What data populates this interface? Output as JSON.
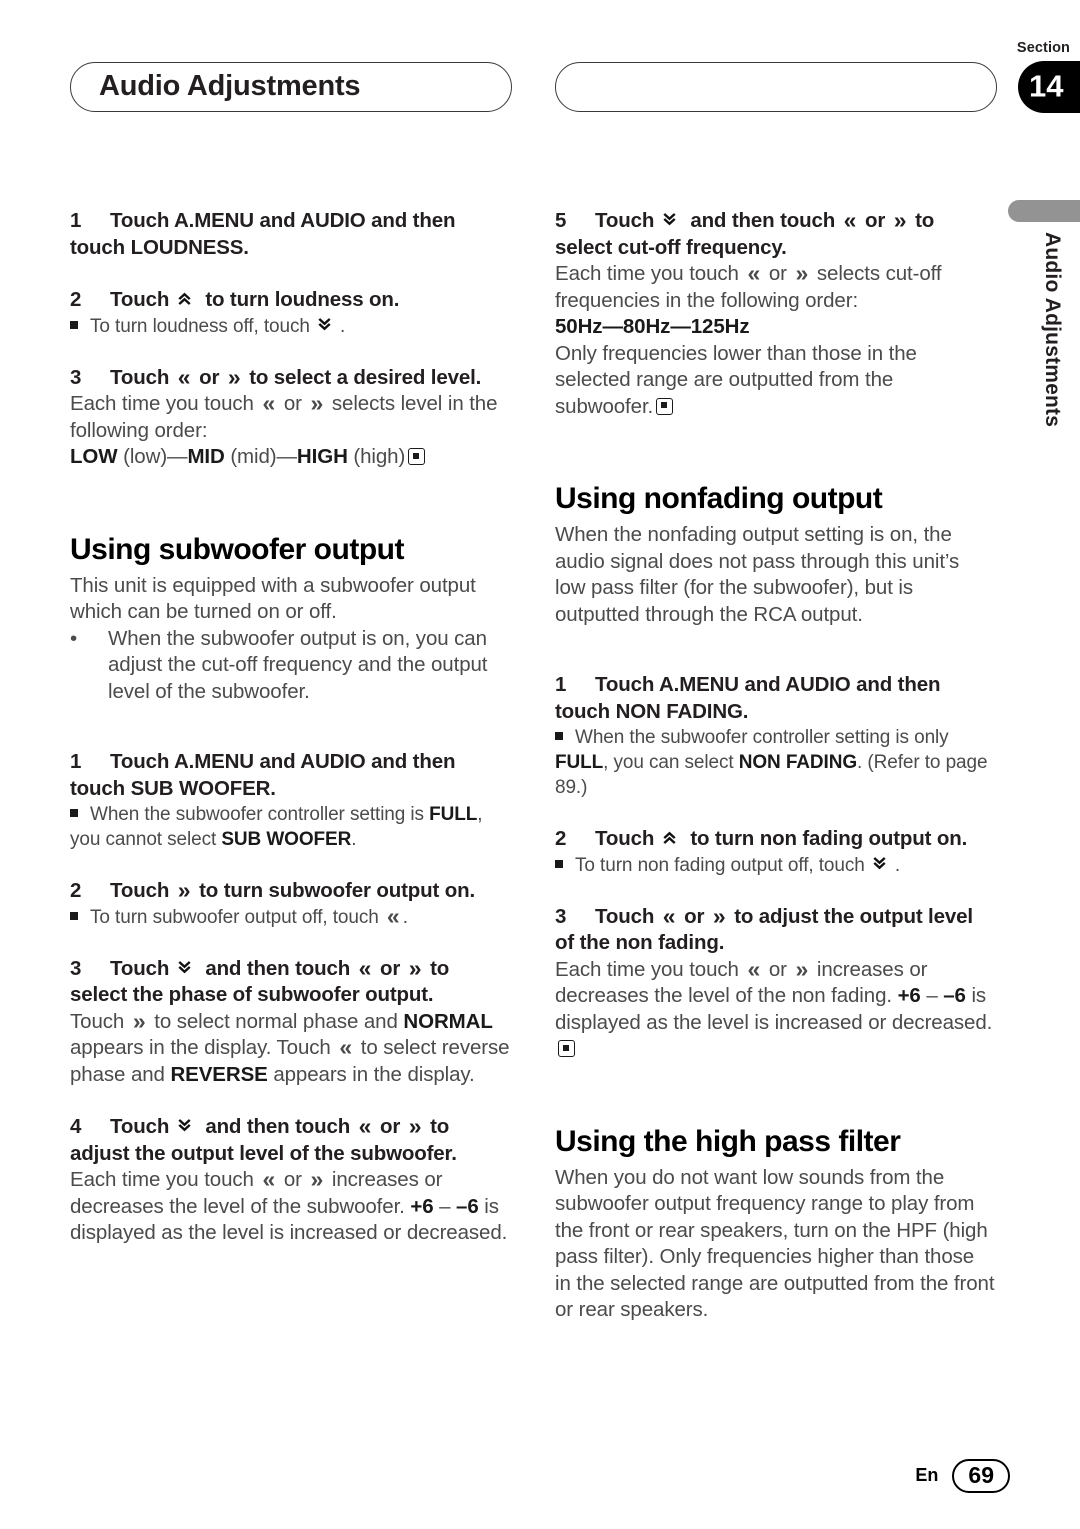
{
  "header": {
    "left_title": "Audio Adjustments",
    "right_title": "",
    "section_label": "Section",
    "section_number": "14"
  },
  "side_tab": {
    "text": "Audio Adjustments"
  },
  "icons": {
    "left": "«",
    "right": "»",
    "up": "double-chevron-up",
    "down": "double-chevron-down",
    "end": "end-of-procedure-marker"
  },
  "left_column": {
    "step1": {
      "num": "1",
      "text": "Touch A.MENU and AUDIO and then touch LOUDNESS."
    },
    "step2": {
      "num": "2",
      "pre": "Touch",
      "post": "to turn loudness on.",
      "note_pre": "To turn loudness off, touch",
      "note_post": "."
    },
    "step3": {
      "num": "3",
      "pre": "Touch",
      "mid": "or",
      "post": "to select a desired level.",
      "body_pre": "Each time you touch",
      "body_mid": "or",
      "body_post": "selects level in the following order:",
      "order_low_b": "LOW",
      "order_low": " (low)—",
      "order_mid_b": "MID",
      "order_mid": " (mid)—",
      "order_high_b": "HIGH",
      "order_high": " (high)"
    },
    "subwoofer_section": {
      "heading": "Using subwoofer output",
      "intro": "This unit is equipped with a subwoofer output which can be turned on or off.",
      "bullet": "When the subwoofer output is on, you can adjust the cut-off frequency and the output level of the subwoofer.",
      "step1": {
        "num": "1",
        "text": "Touch A.MENU and AUDIO and then touch SUB WOOFER.",
        "note_a": "When the subwoofer controller setting is ",
        "note_full": "FULL",
        "note_b": ", you cannot select ",
        "note_sw": "SUB WOOFER",
        "note_c": "."
      },
      "step2": {
        "num": "2",
        "pre": "Touch",
        "post": "to turn subwoofer output on.",
        "note_pre": "To turn subwoofer output off, touch",
        "note_post": "."
      },
      "step3": {
        "num": "3",
        "pre": "Touch",
        "mid1": "and then touch",
        "mid2": "or",
        "post": "to select the phase of subwoofer output.",
        "body_a": "Touch",
        "body_b": "to select normal phase and ",
        "body_normal": "NORMAL",
        "body_c": " appears in the display. Touch",
        "body_d": "to select reverse phase and ",
        "body_reverse": "REVERSE",
        "body_e": " appears in the display."
      },
      "step4": {
        "num": "4",
        "pre": "Touch",
        "mid1": "and then touch",
        "mid2": "or",
        "post": "to adjust the output level of the subwoofer.",
        "body_a": "Each time you touch",
        "body_b": "or",
        "body_c": "increases or decreases the level of the subwoofer. ",
        "body_plus": "+6",
        "body_dash": " – ",
        "body_minus": "–6",
        "body_d": " is displayed as the level is increased or decreased."
      }
    }
  },
  "right_column": {
    "step5": {
      "num": "5",
      "pre": "Touch",
      "mid1": "and then touch",
      "mid2": "or",
      "post": "to select cut-off frequency.",
      "body_a": "Each time you touch",
      "body_b": "or",
      "body_c": "selects cut-off frequencies in the following order:",
      "order": "50Hz—80Hz—125Hz",
      "body_d": "Only frequencies lower than those in the selected range are outputted from the subwoofer."
    },
    "nonfading_section": {
      "heading": "Using nonfading output",
      "intro": "When the nonfading output setting is on, the audio signal does not pass through this unit’s low pass filter (for the subwoofer), but is outputted through the RCA output.",
      "step1": {
        "num": "1",
        "text": "Touch A.MENU and AUDIO and then touch NON FADING.",
        "note_a": "When the subwoofer controller setting is only ",
        "note_full": "FULL",
        "note_b": ", you can select ",
        "note_nf": "NON FADING",
        "note_c": ". (Refer to page 89.)"
      },
      "step2": {
        "num": "2",
        "pre": "Touch",
        "post": "to turn non fading output on.",
        "note_pre": "To turn non fading output off, touch",
        "note_post": "."
      },
      "step3": {
        "num": "3",
        "pre": "Touch",
        "mid": "or",
        "post": "to adjust the output level of the non fading.",
        "body_a": "Each time you touch",
        "body_b": "or",
        "body_c": "increases or decreases the level of the non fading. ",
        "body_plus": "+6",
        "body_dash": " – ",
        "body_minus": "–6",
        "body_d": " is displayed as the level is increased or decreased."
      }
    },
    "hpf_section": {
      "heading": "Using the high pass filter",
      "intro": "When you do not want low sounds from the subwoofer output frequency range to play from the front or rear speakers, turn on the HPF (high pass filter). Only frequencies higher than those in the selected range are outputted from the front or rear speakers."
    }
  },
  "footer": {
    "language": "En",
    "page_number": "69"
  }
}
